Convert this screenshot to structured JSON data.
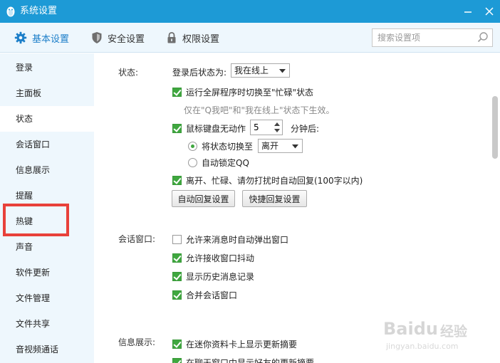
{
  "window": {
    "title": "系统设置",
    "icons": {
      "app": "qq-penguin-icon",
      "minimize": "minimize-icon",
      "close": "close-icon"
    }
  },
  "toolbar": {
    "tabs": [
      {
        "label": "基本设置",
        "icon": "gear-icon",
        "active": true
      },
      {
        "label": "安全设置",
        "icon": "shield-icon",
        "active": false
      },
      {
        "label": "权限设置",
        "icon": "lock-icon",
        "active": false
      }
    ],
    "search": {
      "placeholder": "搜索设置项",
      "value": "",
      "icon": "search-icon"
    }
  },
  "sidebar": {
    "items": [
      {
        "label": "登录"
      },
      {
        "label": "主面板"
      },
      {
        "label": "状态"
      },
      {
        "label": "会话窗口"
      },
      {
        "label": "信息展示"
      },
      {
        "label": "提醒"
      },
      {
        "label": "热键"
      },
      {
        "label": "声音"
      },
      {
        "label": "软件更新"
      },
      {
        "label": "文件管理"
      },
      {
        "label": "文件共享"
      },
      {
        "label": "音视频通话"
      }
    ],
    "active_index": 2,
    "highlighted_index": 6
  },
  "status_section": {
    "label": "状态:",
    "login_status_label": "登录后状态为:",
    "login_status_value": "我在线上",
    "fullscreen_busy": {
      "label": "运行全屏程序时切换至\"忙碌\"状态",
      "checked": true
    },
    "fullscreen_hint": "仅在\"Q我吧\"和\"我在线上\"状态下生效。",
    "idle": {
      "label": "鼠标键盘无动作",
      "checked": true,
      "minutes": "5",
      "suffix": "分钟后:"
    },
    "switch_to": {
      "label": "将状态切换至",
      "checked": true,
      "value": "离开"
    },
    "auto_lock": {
      "label": "自动锁定QQ",
      "checked": false
    },
    "auto_reply": {
      "label": "离开、忙碌、请勿打扰时自动回复(100字以内)",
      "checked": true
    },
    "buttons": {
      "auto_reply_settings": "自动回复设置",
      "quick_reply_settings": "快捷回复设置"
    }
  },
  "chat_section": {
    "label": "会话窗口:",
    "options": [
      {
        "label": "允许来消息时自动弹出窗口",
        "checked": false
      },
      {
        "label": "允许接收窗口抖动",
        "checked": true
      },
      {
        "label": "显示历史消息记录",
        "checked": true
      },
      {
        "label": "合并会话窗口",
        "checked": true
      }
    ]
  },
  "info_section": {
    "label": "信息展示:",
    "options": [
      {
        "label": "在迷你资料卡上显示更新摘要",
        "checked": true
      },
      {
        "label": "在聊天窗口中显示好友的更新摘要",
        "checked": true
      }
    ]
  },
  "watermark": {
    "brand": "Baidu",
    "brand_cn": "经验",
    "url": "jingyan.baidu.com"
  },
  "colors": {
    "titlebar": "#1d9ad6",
    "accent": "#1d7fc9",
    "checkbox": "#3fa73f",
    "annotation": "#e8413a"
  }
}
